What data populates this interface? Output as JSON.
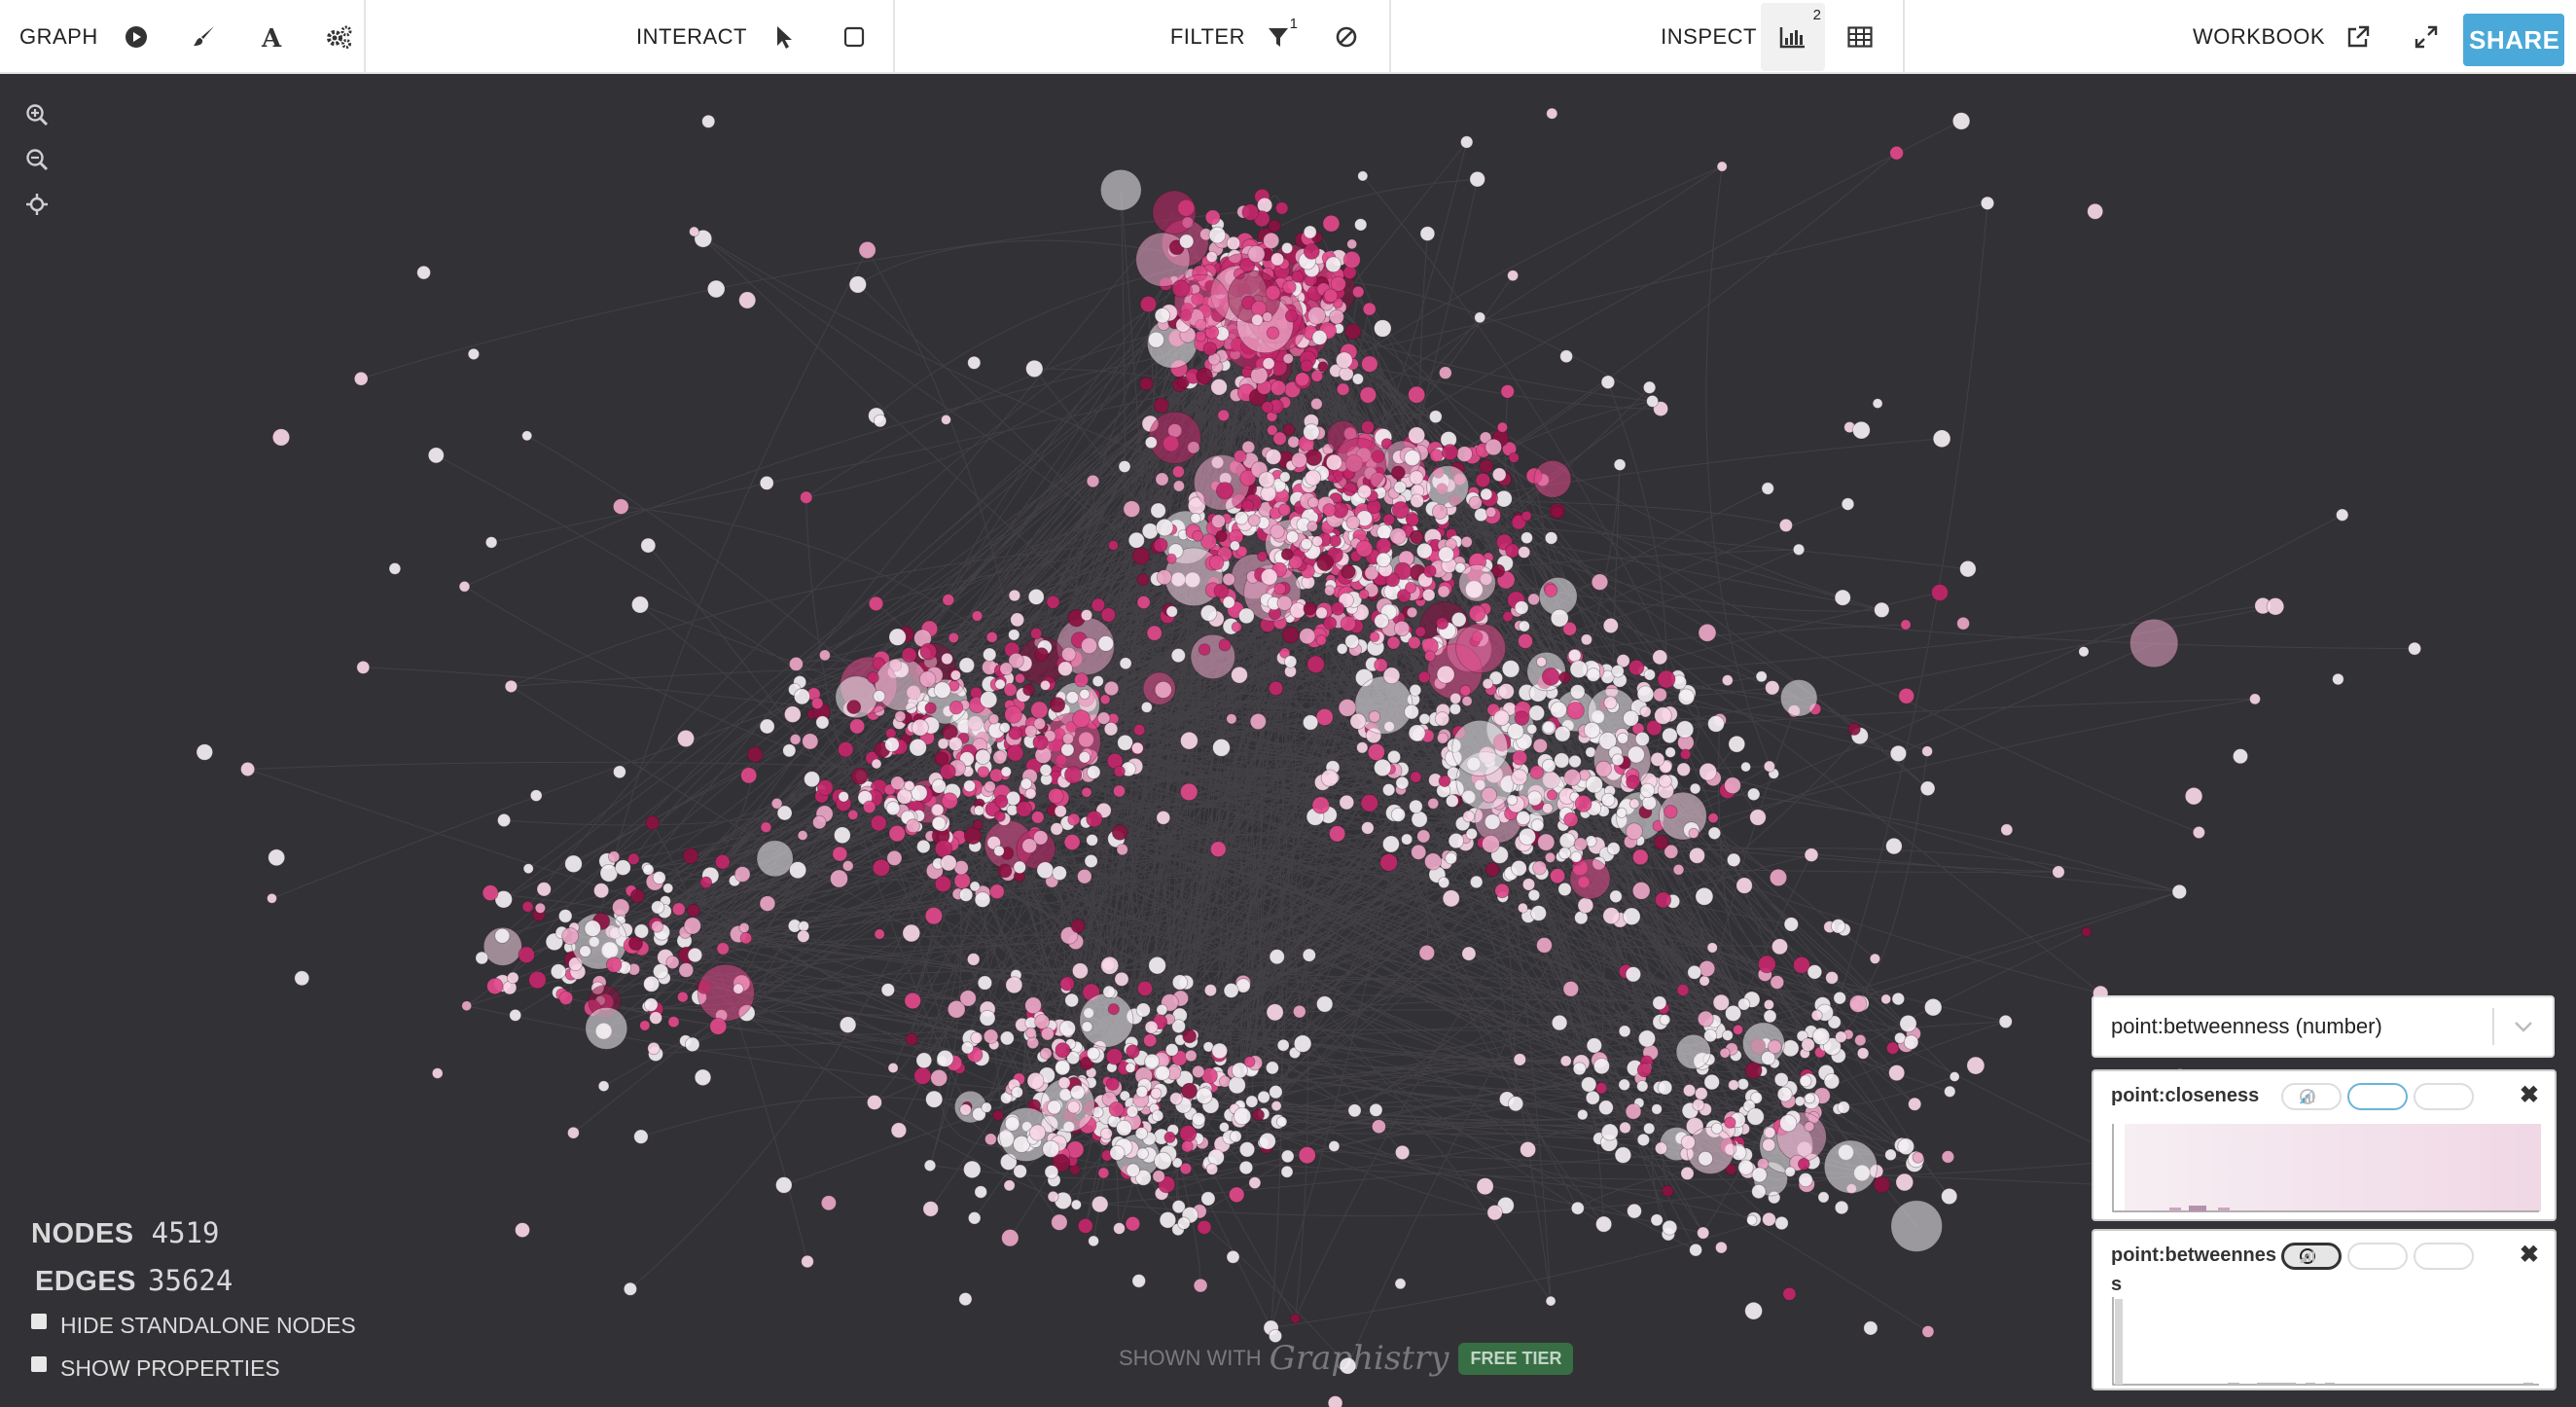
{
  "toolbar": {
    "graph_label": "GRAPH",
    "interact_label": "INTERACT",
    "filter_label": "FILTER",
    "filter_count": "1",
    "inspect_label": "INSPECT",
    "inspect_count": "2",
    "workbook_label": "WORKBOOK",
    "share_label": "SHARE",
    "icons": {
      "graph": [
        "play-icon",
        "brush-icon",
        "font-icon",
        "gears-icon"
      ],
      "interact": [
        "pointer-icon",
        "select-box-icon"
      ],
      "filter": [
        "funnel-icon",
        "ban-icon"
      ],
      "inspect": [
        "histogram-icon",
        "table-icon"
      ],
      "workbook": [
        "external-link-icon",
        "expand-icon"
      ]
    }
  },
  "canvas": {
    "background": "#323236",
    "zoom_controls": [
      "zoom-in-icon",
      "zoom-out-icon",
      "center-icon"
    ]
  },
  "stats": {
    "nodes_label": "NODES",
    "nodes_value": "4519",
    "edges_label": "EDGES",
    "edges_value": "35624"
  },
  "options": {
    "hide_standalone": "HIDE STANDALONE NODES",
    "show_properties": "SHOW PROPERTIES"
  },
  "watermark": {
    "shown_with": "SHOWN WITH",
    "brand": "Graphistry",
    "tier": "FREE TIER"
  },
  "histograms": {
    "selected_attribute": "point:betweenness (number)",
    "cards": [
      {
        "title": "point:closeness",
        "active_mode": "brush"
      },
      {
        "title": "point:betweenness",
        "active_mode": "target"
      }
    ]
  },
  "colors": {
    "accent": "#4aa9d8",
    "node_light": "#f2eef2",
    "node_pink": "#e0498a",
    "node_dark": "#8a1040"
  }
}
